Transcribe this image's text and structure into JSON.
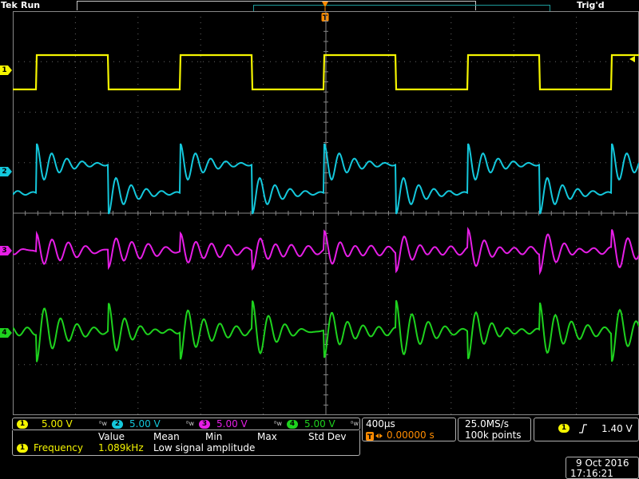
{
  "header": {
    "brand": "Tek",
    "status": "Run",
    "trigger_state": "Trig'd"
  },
  "colors": {
    "ch1": "#f5f500",
    "ch2": "#14c8dc",
    "ch3": "#e61ee6",
    "ch4": "#1ed21e",
    "accent": "#ff8c00"
  },
  "channels": [
    {
      "number": "1",
      "scale": "5.00 V",
      "bw_icon": "bw-limit-icon"
    },
    {
      "number": "2",
      "scale": "5.00 V",
      "bw_icon": "bw-limit-icon"
    },
    {
      "number": "3",
      "scale": "5.00 V",
      "bw_icon": "bw-limit-icon"
    },
    {
      "number": "4",
      "scale": "5.00 V",
      "bw_icon": "bw-limit-icon"
    }
  ],
  "measurement": {
    "headers": [
      "Value",
      "Mean",
      "Min",
      "Max",
      "Std Dev"
    ],
    "source": "1",
    "name": "Frequency",
    "value": "1.089kHz",
    "note": "Low signal amplitude"
  },
  "timebase": {
    "scale": "400µs",
    "delay_marker": "T",
    "delay": "0.00000 s"
  },
  "acquisition": {
    "sample_rate": "25.0MS/s",
    "record_length": "100k points"
  },
  "trigger": {
    "source": "1",
    "slope_icon": "rising-edge-icon",
    "level": "1.40 V"
  },
  "datetime": {
    "date": "9 Oct  2016",
    "time": "17:16:21"
  },
  "markers": {
    "trigger_pos": "T",
    "ch_labels": [
      "1",
      "2",
      "3",
      "4"
    ]
  }
}
